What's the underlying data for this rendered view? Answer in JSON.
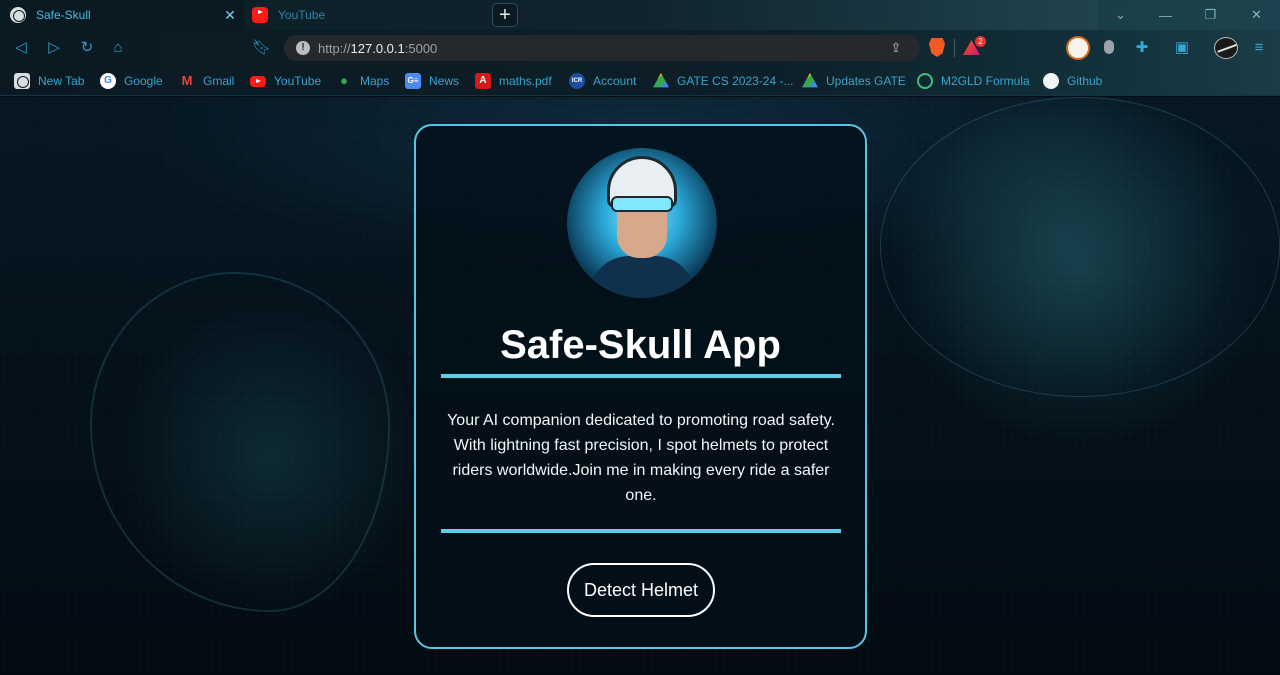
{
  "tabs": [
    {
      "title": "Safe-Skull",
      "active": true
    },
    {
      "title": "YouTube",
      "active": false
    }
  ],
  "address_bar": {
    "url_prefix": "http://",
    "url_host": "127.0.0.1",
    "url_suffix": ":5000"
  },
  "extensions": {
    "brave_badge": "2"
  },
  "bookmarks": [
    {
      "label": "New Tab",
      "icon": "globe-icon"
    },
    {
      "label": "Google",
      "icon": "google-icon"
    },
    {
      "label": "Gmail",
      "icon": "gmail-icon"
    },
    {
      "label": "YouTube",
      "icon": "youtube-icon"
    },
    {
      "label": "Maps",
      "icon": "maps-icon"
    },
    {
      "label": "News",
      "icon": "news-icon"
    },
    {
      "label": "maths.pdf",
      "icon": "pdf-icon"
    },
    {
      "label": "Account",
      "icon": "icr-icon"
    },
    {
      "label": "GATE CS 2023-24 -...",
      "icon": "drive-icon"
    },
    {
      "label": "Updates GATE",
      "icon": "drive-icon"
    },
    {
      "label": "M2GLD Formula",
      "icon": "m2gld-icon"
    },
    {
      "label": "Github",
      "icon": "github-icon"
    }
  ],
  "card": {
    "title": "Safe-Skull App",
    "description": "Your AI companion dedicated to promoting road safety. With lightning fast precision, I spot helmets to protect riders worldwide.Join me in making every ride a safer one.",
    "button_label": "Detect Helmet"
  },
  "colors": {
    "accent": "#5ecde8",
    "card_border": "#59c5e3",
    "bookmark_text": "#3aa3cf",
    "tab_text": "#49b8e0"
  }
}
